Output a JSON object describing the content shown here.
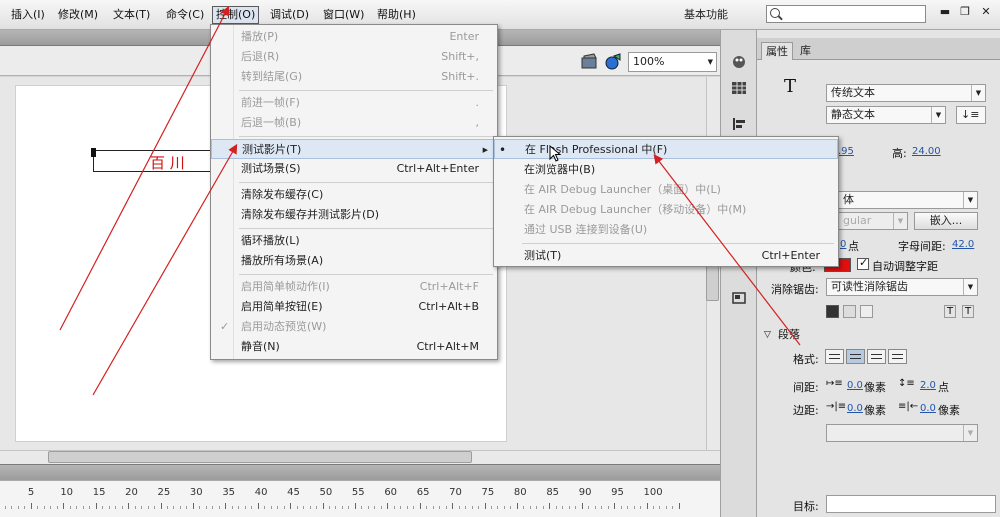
{
  "menubar": {
    "items": [
      "插入(I)",
      "修改(M)",
      "文本(T)",
      "命令(C)",
      "控制(O)",
      "调试(D)",
      "窗口(W)",
      "帮助(H)"
    ],
    "workspace": "基本功能",
    "search_value": ""
  },
  "window_buttons": [
    "▬",
    "❐",
    "✕"
  ],
  "edit_bar": {
    "zoom": "100%"
  },
  "stage": {
    "text": "百  川"
  },
  "control_menu": {
    "items": [
      {
        "label": "播放(P)",
        "shortcut": "Enter",
        "disabled": true
      },
      {
        "label": "后退(R)",
        "shortcut": "Shift+,",
        "disabled": true
      },
      {
        "label": "转到结尾(G)",
        "shortcut": "Shift+.",
        "disabled": true
      },
      {
        "label": "前进一帧(F)",
        "shortcut": ".",
        "disabled": true
      },
      {
        "label": "后退一帧(B)",
        "shortcut": ",",
        "disabled": true
      },
      {
        "label": "测试影片(T)",
        "shortcut": "",
        "disabled": false
      },
      {
        "label": "测试场景(S)",
        "shortcut": "Ctrl+Alt+Enter",
        "disabled": false
      },
      {
        "label": "清除发布缓存(C)",
        "shortcut": "",
        "disabled": false
      },
      {
        "label": "清除发布缓存并测试影片(D)",
        "shortcut": "",
        "disabled": false
      },
      {
        "label": "循环播放(L)",
        "shortcut": "",
        "disabled": false
      },
      {
        "label": "播放所有场景(A)",
        "shortcut": "",
        "disabled": false
      },
      {
        "label": "启用简单帧动作(I)",
        "shortcut": "Ctrl+Alt+F",
        "disabled": true
      },
      {
        "label": "启用简单按钮(E)",
        "shortcut": "Ctrl+Alt+B",
        "disabled": false
      },
      {
        "label": "启用动态预览(W)",
        "shortcut": "",
        "disabled": true
      },
      {
        "label": "静音(N)",
        "shortcut": "Ctrl+Alt+M",
        "disabled": false
      }
    ]
  },
  "test_movie_submenu": {
    "items": [
      {
        "label": "在 Flash Professional 中(F)",
        "shortcut": "",
        "disabled": false
      },
      {
        "label": "在浏览器中(B)",
        "shortcut": "",
        "disabled": false
      },
      {
        "label": "在 AIR Debug Launcher（桌面）中(L)",
        "shortcut": "",
        "disabled": true
      },
      {
        "label": "在 AIR Debug Launcher（移动设备）中(M)",
        "shortcut": "",
        "disabled": true
      },
      {
        "label": "通过 USB 连接到设备(U)",
        "shortcut": "",
        "disabled": true
      },
      {
        "label": "测试(T)",
        "shortcut": "Ctrl+Enter",
        "disabled": false
      }
    ]
  },
  "properties": {
    "tabs": [
      "属性",
      "库"
    ],
    "text_tool_icon": "T",
    "text_engine": "传统文本",
    "text_type": "静态文本",
    "width_value": ".95",
    "height_label": "高:",
    "height_value": "24.00",
    "font_family": "体",
    "font_style": "gular",
    "embed_button": "嵌入...",
    "size_value": "0",
    "size_unit": "点",
    "letter_spacing_label": "字母间距:",
    "letter_spacing_value": "42.0",
    "color_label": "颜色:",
    "auto_kern_label": "自动调整字距",
    "antialias_label": "消除锯齿:",
    "antialias_value": "可读性消除锯齿",
    "paragraph_section": "段落",
    "format_label": "格式:",
    "spacing_label": "间距:",
    "spacing_indent": "0.0",
    "spacing_indent_unit": "像素",
    "spacing_line": "2.0",
    "spacing_line_unit": "点",
    "margins_label": "边距:",
    "margin_left": "0.0",
    "margin_left_unit": "像素",
    "margin_right": "0.0",
    "margin_right_unit": "像素",
    "target_label": "目标:",
    "color_swatch": "#e01010"
  },
  "ruler": {
    "labels": [
      "5",
      "10",
      "15",
      "20",
      "25",
      "30",
      "35",
      "40",
      "45",
      "50",
      "55",
      "60",
      "65",
      "70",
      "75",
      "80",
      "85",
      "90",
      "95",
      "100"
    ]
  },
  "colors": {
    "annotation": "#d42020",
    "text_red": "#d01010",
    "menu_highlight": "#dde8f4"
  }
}
